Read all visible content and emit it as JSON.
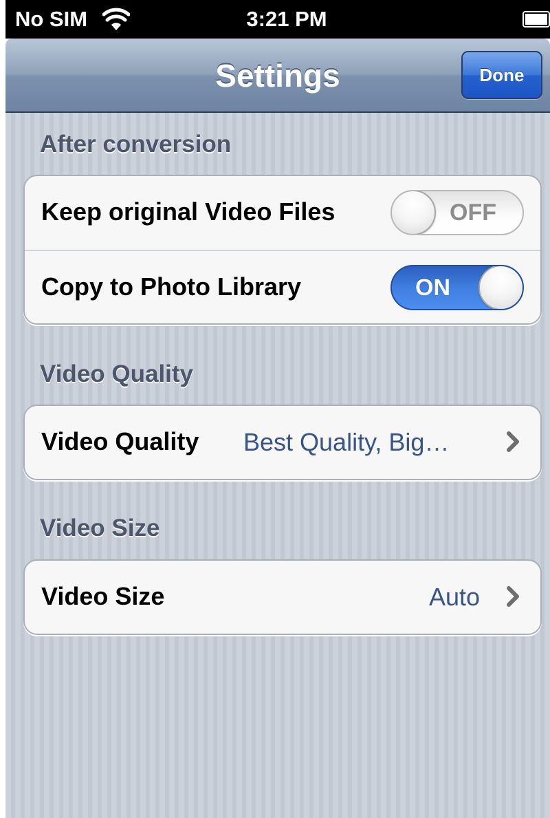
{
  "status_bar": {
    "carrier": "No SIM",
    "time": "3:21 PM",
    "wifi_icon": "wifi-icon",
    "battery_icon": "battery-icon"
  },
  "nav_bar": {
    "title": "Settings",
    "done_label": "Done"
  },
  "sections": {
    "after_conversion": {
      "header": "After conversion",
      "keep_original": {
        "label": "Keep original Video Files",
        "state": "OFF"
      },
      "copy_to_library": {
        "label": "Copy to Photo Library",
        "state": "ON"
      }
    },
    "video_quality": {
      "header": "Video Quality",
      "row_label": "Video Quality",
      "row_value": "Best Quality, Big…",
      "chevron_icon": "chevron-right-icon"
    },
    "video_size": {
      "header": "Video Size",
      "row_label": "Video Size",
      "row_value": "Auto",
      "chevron_icon": "chevron-right-icon"
    }
  },
  "colors": {
    "nav_bar": "#7d91ad",
    "done_button": "#2462cf",
    "switch_on": "#3f7fe0",
    "detail_text": "#385487",
    "section_header": "#4c566c"
  }
}
